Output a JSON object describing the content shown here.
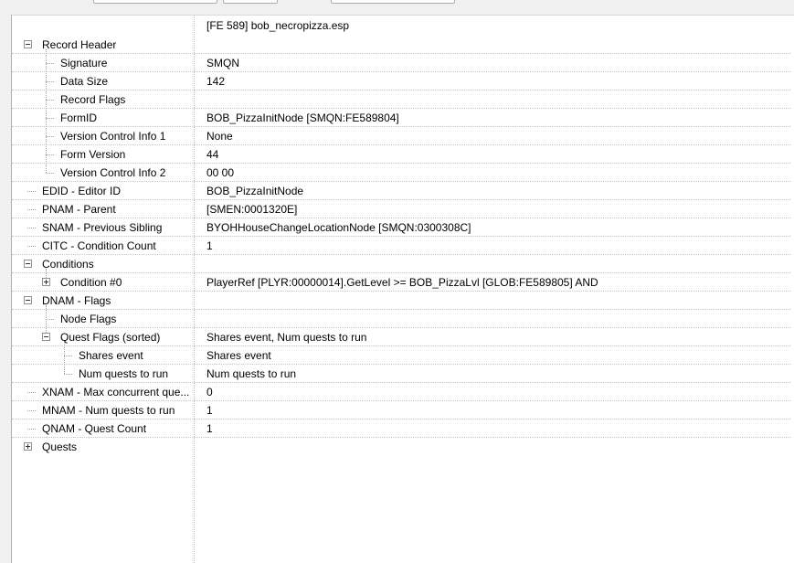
{
  "header": {
    "file_label": "[FE 589] bob_necropizza.esp"
  },
  "tree": {
    "rows": [
      {
        "name": "Record Header",
        "value": "",
        "expander": "minus"
      },
      {
        "name": "Signature",
        "value": "SMQN"
      },
      {
        "name": "Data Size",
        "value": "142"
      },
      {
        "name": "Record Flags",
        "value": ""
      },
      {
        "name": "FormID",
        "value": "BOB_PizzaInitNode [SMQN:FE589804]"
      },
      {
        "name": "Version Control Info 1",
        "value": "None"
      },
      {
        "name": "Form Version",
        "value": "44"
      },
      {
        "name": "Version Control Info 2",
        "value": "00 00"
      },
      {
        "name": "EDID - Editor ID",
        "value": "BOB_PizzaInitNode"
      },
      {
        "name": "PNAM - Parent",
        "value": "[SMEN:0001320E]"
      },
      {
        "name": "SNAM - Previous Sibling",
        "value": "BYOHHouseChangeLocationNode [SMQN:0300308C]"
      },
      {
        "name": "CITC - Condition Count",
        "value": "1"
      },
      {
        "name": "Conditions",
        "value": "",
        "expander": "minus"
      },
      {
        "name": "Condition #0",
        "value": "PlayerRef [PLYR:00000014].GetLevel >= BOB_PizzaLvl [GLOB:FE589805] AND",
        "expander": "plus"
      },
      {
        "name": "DNAM - Flags",
        "value": "",
        "expander": "minus"
      },
      {
        "name": "Node Flags",
        "value": ""
      },
      {
        "name": "Quest Flags (sorted)",
        "value": "Shares event, Num quests to run",
        "expander": "minus"
      },
      {
        "name": "Shares event",
        "value": "Shares event"
      },
      {
        "name": "Num quests to run",
        "value": "Num quests to run"
      },
      {
        "name": "XNAM - Max concurrent que...",
        "value": "0"
      },
      {
        "name": "MNAM - Num quests to run",
        "value": "1"
      },
      {
        "name": "QNAM - Quest Count",
        "value": "1"
      },
      {
        "name": "Quests",
        "value": "",
        "expander": "plus"
      }
    ]
  },
  "colors": {
    "window_bg": "#f0f0f0",
    "tree_bg": "#ffffff",
    "guide_line": "#a0a0a0",
    "row_separator": "#c6c6c6"
  }
}
